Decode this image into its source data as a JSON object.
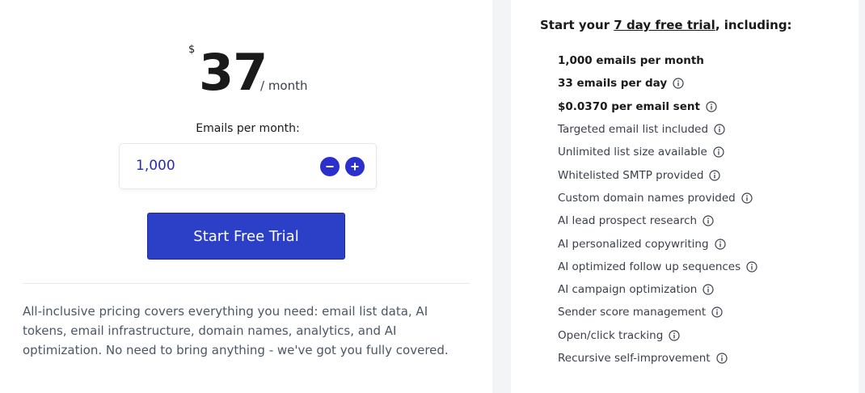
{
  "price": {
    "currency": "$",
    "amount": "37",
    "period": "/ month"
  },
  "emails": {
    "label": "Emails per month:",
    "value": "1,000"
  },
  "cta": {
    "label": "Start Free Trial"
  },
  "blurb": "All-inclusive pricing covers everything you need: email list data, AI tokens, email infrastructure, domain names, analytics, and AI optimization. No need to bring anything - we've got you fully covered.",
  "trial": {
    "prefix": "Start your ",
    "highlight": "7 day free trial",
    "suffix": ", including:"
  },
  "features": [
    {
      "text": "1,000 emails per month",
      "bold": true,
      "info": false
    },
    {
      "text": "33 emails per day",
      "bold": true,
      "info": true
    },
    {
      "text": "$0.0370 per email sent",
      "bold": true,
      "info": true
    },
    {
      "text": "Targeted email list included",
      "bold": false,
      "info": true
    },
    {
      "text": "Unlimited list size available",
      "bold": false,
      "info": true
    },
    {
      "text": "Whitelisted SMTP provided",
      "bold": false,
      "info": true
    },
    {
      "text": "Custom domain names provided",
      "bold": false,
      "info": true
    },
    {
      "text": "AI lead prospect research",
      "bold": false,
      "info": true
    },
    {
      "text": "AI personalized copywriting",
      "bold": false,
      "info": true
    },
    {
      "text": "AI optimized follow up sequences",
      "bold": false,
      "info": true
    },
    {
      "text": "AI campaign optimization",
      "bold": false,
      "info": true
    },
    {
      "text": "Sender score management",
      "bold": false,
      "info": true
    },
    {
      "text": "Open/click tracking",
      "bold": false,
      "info": true
    },
    {
      "text": "Recursive self-improvement",
      "bold": false,
      "info": true
    }
  ],
  "icons": {
    "minus": "minus-icon",
    "plus": "plus-icon",
    "info": "info-icon"
  },
  "colors": {
    "accent": "#2b3fc7",
    "stepper_value": "#2a2bb5",
    "text_dark": "#1a1a1a",
    "text_muted": "#4c5665"
  }
}
